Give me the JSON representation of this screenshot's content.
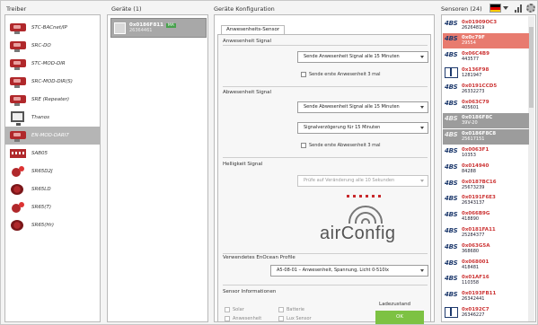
{
  "headers": {
    "treiber": "Treiber",
    "geraete": "Geräte (1)",
    "konfig": "Geräte Konfiguration",
    "sensoren": "Sensoren (24)"
  },
  "drivers": [
    {
      "label": "STC-BACnet/IP",
      "icon": "device-icon"
    },
    {
      "label": "SRC-DO",
      "icon": "device-icon"
    },
    {
      "label": "STC-MOD-DIR",
      "icon": "device-icon"
    },
    {
      "label": "SRC-MOD-DIR(S)",
      "icon": "device-icon"
    },
    {
      "label": "SRE (Repeater)",
      "icon": "device-icon"
    },
    {
      "label": "Thanos",
      "icon": "monitor-icon"
    },
    {
      "label": "EN-MOD-DARI7",
      "icon": "device-icon",
      "selected": true
    },
    {
      "label": "SAB05",
      "icon": "strip-icon"
    },
    {
      "label": "SR65D2J",
      "icon": "sensor-icon"
    },
    {
      "label": "SR65LD",
      "icon": "sensor-icon"
    },
    {
      "label": "SR65(T)",
      "icon": "sensor-icon"
    },
    {
      "label": "SR65(Hr)",
      "icon": "sensor-icon"
    }
  ],
  "device": {
    "id": "0x0186F811",
    "serial": "26364461",
    "badge": "MA"
  },
  "config": {
    "tab": "Anwesenheits-Sensor",
    "anw_title": "Anwesenheit Signal",
    "anw_dd": "Sende Anwesenheit Signal alle 15 Minuten",
    "anw_cb": "Sende erste Anwesenheit 3 mal",
    "abw_title": "Abwesenheit Signal",
    "abw_dd1": "Sende Abwesenheit Signal alle 15 Minuten",
    "abw_dd2": "Signalverzögerung für 15 Minuten",
    "abw_cb": "Sende erste Abwesenheit 3 mal",
    "hell_title": "Helligkeit Signal",
    "hell_dd": "Prüfe auf Veränderung alle 10 Sekunden",
    "eep_title": "Verwendetes EnOcean Profile",
    "eep_dd": "A5-08-01 – Anwesenheit, Spannung, Licht 0-510lx",
    "info_title": "Sensor Informationen",
    "info_cbs": [
      "Solar",
      "Batterie",
      "Anwesenheit",
      "Lux Sensor"
    ],
    "ladezustand": "Ladezustand",
    "ok": "OK"
  },
  "logo": {
    "text_air": "air",
    "text_config": "Config",
    "dot_color": "#c8282b"
  },
  "sensors": [
    {
      "id": "0x01909OC3",
      "num": "26264819"
    },
    {
      "id": "0x0c79F",
      "num": "29554",
      "state": "red"
    },
    {
      "id": "0x06C4B9",
      "num": "443577"
    },
    {
      "id": "0x136F98",
      "num": "1281947"
    },
    {
      "id": "0x0191CCD5",
      "num": "26332273"
    },
    {
      "id": "0x063C79",
      "num": "405601"
    },
    {
      "id": "0x0186F8C",
      "num": "39V-20",
      "state": "grey"
    },
    {
      "id": "0x0186F8C8",
      "num": "25617151",
      "state": "grey"
    },
    {
      "id": "0x0063F1",
      "num": "10353"
    },
    {
      "id": "0x014940",
      "num": "84288"
    },
    {
      "id": "0x0187BC16",
      "num": "25673239"
    },
    {
      "id": "0x0191F6E3",
      "num": "26343137"
    },
    {
      "id": "0x066B9G",
      "num": "418890"
    },
    {
      "id": "0x0181FA11",
      "num": "25284377"
    },
    {
      "id": "0x063G5A",
      "num": "368680"
    },
    {
      "id": "0x068001",
      "num": "418481"
    },
    {
      "id": "0x01AF16",
      "num": "110358"
    },
    {
      "id": "0x0193FB11",
      "num": "26342441"
    },
    {
      "id": "0x0192C7",
      "num": "26346227"
    }
  ]
}
